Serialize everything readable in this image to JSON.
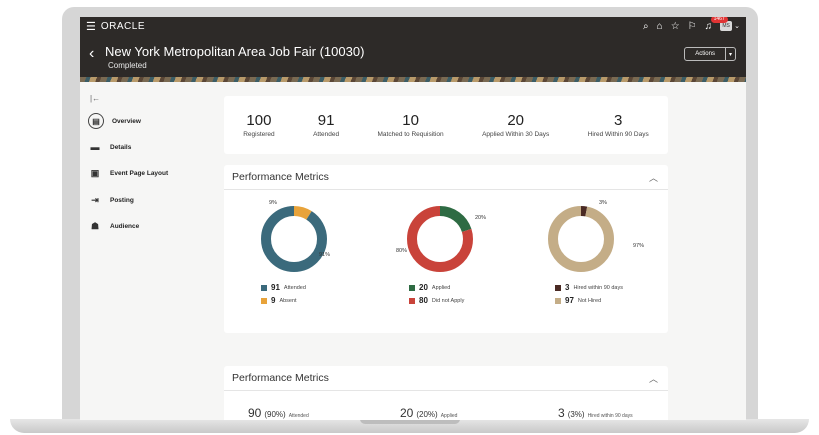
{
  "topbar": {
    "brand": "ORACLE",
    "notification_count": "1467",
    "avatar_initials": "MS"
  },
  "header": {
    "title": "New York Metropolitan Area Job Fair (10030)",
    "status": "Completed",
    "actions_label": "Actions"
  },
  "sidebar": {
    "items": [
      {
        "label": "Overview",
        "icon": "overview-icon",
        "active": true
      },
      {
        "label": "Details",
        "icon": "details-icon"
      },
      {
        "label": "Event Page Layout",
        "icon": "layout-icon"
      },
      {
        "label": "Posting",
        "icon": "posting-icon"
      },
      {
        "label": "Audience",
        "icon": "audience-icon"
      }
    ]
  },
  "stats": [
    {
      "value": "100",
      "label": "Registered"
    },
    {
      "value": "91",
      "label": "Attended"
    },
    {
      "value": "10",
      "label": "Matched to Requisition"
    },
    {
      "value": "20",
      "label": "Applied Within 30 Days"
    },
    {
      "value": "3",
      "label": "Hired Within 90 Days"
    }
  ],
  "performance": {
    "title": "Performance Metrics",
    "charts": [
      {
        "labels_pct": [
          "9%",
          "91%"
        ],
        "legend": [
          {
            "value": "91",
            "label": "Attended",
            "color": "#3b6a7c"
          },
          {
            "value": "9",
            "label": "Absent",
            "color": "#e8a33a"
          }
        ]
      },
      {
        "labels_pct": [
          "20%",
          "80%"
        ],
        "legend": [
          {
            "value": "20",
            "label": "Applied",
            "color": "#2e6b43"
          },
          {
            "value": "80",
            "label": "Did not Apply",
            "color": "#c9433a"
          }
        ]
      },
      {
        "labels_pct": [
          "3%",
          "97%"
        ],
        "legend": [
          {
            "value": "3",
            "label": "Hired within 90 days",
            "color": "#4a2a24"
          },
          {
            "value": "97",
            "label": "Not Hired",
            "color": "#c4ad87"
          }
        ]
      }
    ]
  },
  "performance2": {
    "title": "Performance Metrics",
    "items": [
      {
        "value": "90",
        "pct": "(90%)",
        "label": "Attended"
      },
      {
        "value": "20",
        "pct": "(20%)",
        "label": "Applied"
      },
      {
        "value": "3",
        "pct": "(3%)",
        "label": "Hired within 90 days"
      }
    ]
  },
  "chart_data": [
    {
      "type": "pie",
      "categories": [
        "Absent",
        "Attended"
      ],
      "values": [
        9,
        91
      ]
    },
    {
      "type": "pie",
      "categories": [
        "Applied",
        "Did not Apply"
      ],
      "values": [
        20,
        80
      ]
    },
    {
      "type": "pie",
      "categories": [
        "Hired within 90 days",
        "Not Hired"
      ],
      "values": [
        3,
        97
      ]
    }
  ]
}
